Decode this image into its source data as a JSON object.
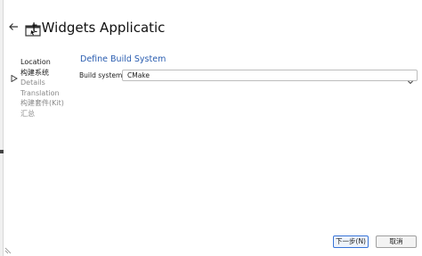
{
  "window": {
    "title": "t Widgets Applicatic",
    "back_icon": "back-arrow-icon",
    "app_icon": "monitor-icon"
  },
  "steps": [
    {
      "label": "Location",
      "state": "done"
    },
    {
      "label": "构建系统",
      "state": "active"
    },
    {
      "label": "Details",
      "state": "pending"
    },
    {
      "label": "Translation",
      "state": "pending"
    },
    {
      "label": "构建套件(Kit)",
      "state": "pending"
    },
    {
      "label": "汇总",
      "state": "pending"
    }
  ],
  "page": {
    "title": "Define Build System",
    "build_system_label": "Build system:",
    "build_system_value": "CMake"
  },
  "buttons": {
    "next": "下一步(N)",
    "cancel": "取消"
  },
  "colors": {
    "accent": "#2a5db0",
    "primary_border": "#3874d8"
  }
}
